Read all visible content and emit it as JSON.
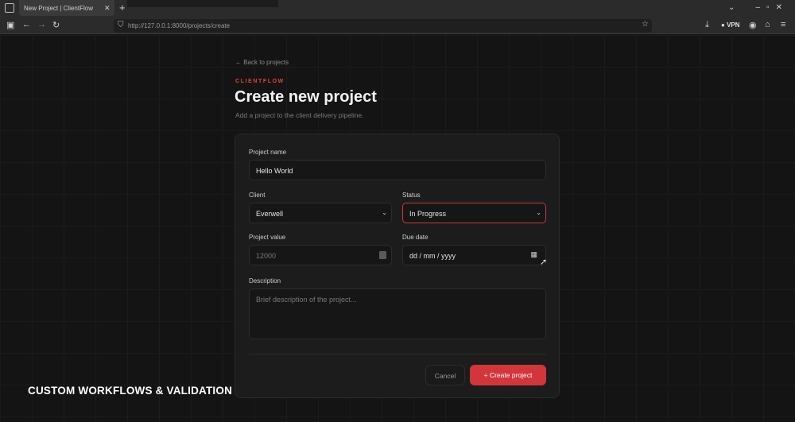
{
  "browser": {
    "tab_title": "New Project | ClientFlow",
    "tab_close": "✕",
    "new_tab": "+",
    "url": "http://127.0.0.1:8000/projects/create",
    "vpn_label": "VPN",
    "window_buttons": "–▫✕"
  },
  "header": {
    "back_link": "← Back to projects",
    "brand": "CLIENTFLOW",
    "title": "Create new project",
    "subtitle": "Add a project to the client delivery pipeline."
  },
  "form": {
    "project_name_label": "Project name",
    "project_name_value": "Hello World",
    "client_label": "Client",
    "client_value": "Everwell",
    "status_label": "Status",
    "status_value": "In Progress",
    "project_value_label": "Project value",
    "project_value_value": "12000",
    "due_date_label": "Due date",
    "due_date_placeholder": "dd / mm / yyyy",
    "description_label": "Description",
    "description_placeholder": "Brief description of the project...",
    "cancel_label": "Cancel",
    "create_label": "+  Create project"
  },
  "overlay": {
    "caption": "CUSTOM WORKFLOWS & VALIDATION"
  },
  "colors": {
    "accent": "#d2353a",
    "background": "#141414",
    "card": "#1c1c1c"
  }
}
